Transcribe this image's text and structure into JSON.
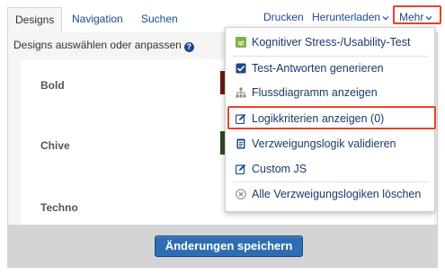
{
  "tabs": [
    {
      "label": "Designs"
    },
    {
      "label": "Navigation"
    },
    {
      "label": "Suchen"
    }
  ],
  "actions": {
    "print": "Drucken",
    "download": "Herunterladen",
    "more": "Mehr"
  },
  "panel": {
    "subtitle": "Designs auswählen oder anpassen",
    "designs": [
      {
        "name": "Bold",
        "color": "#6b1a12"
      },
      {
        "name": "Chive",
        "color": "#2f4a24"
      },
      {
        "name": "Techno",
        "color": "#5a5a5a"
      }
    ]
  },
  "footer": {
    "save_label": "Änderungen speichern"
  },
  "menu": {
    "items": [
      {
        "label": "Kognitiver Stress-/Usability-Test",
        "icon": "qt-badge-icon"
      },
      {
        "label": "Test-Antworten generieren",
        "icon": "checkbox-icon"
      },
      {
        "label": "Flussdiagramm anzeigen",
        "icon": "sitemap-icon"
      },
      {
        "label": "Logikkriterien anzeigen (0)",
        "icon": "edit-icon"
      },
      {
        "label": "Verzweigungslogik validieren",
        "icon": "clipboard-icon"
      },
      {
        "label": "Custom JS",
        "icon": "edit-icon"
      },
      {
        "label": "Alle Verzweigungslogiken löschen",
        "icon": "circle-x-icon"
      }
    ]
  },
  "colors": {
    "link": "#1a4a8a",
    "highlight": "#e8422b",
    "button": "#2f6db3"
  }
}
